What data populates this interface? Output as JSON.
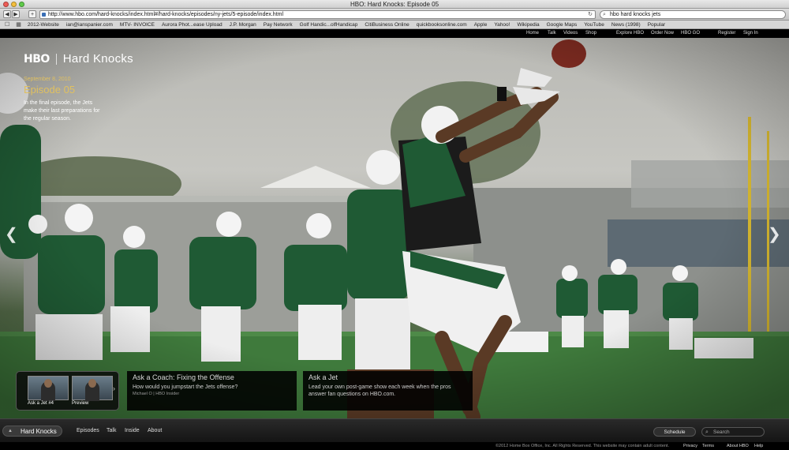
{
  "window": {
    "title": "HBO: Hard Knocks: Episode 05"
  },
  "browser": {
    "url": "http://www.hbo.com/hard-knocks/index.html#/hard-knocks/episodes/ny-jets/5-episode/index.html",
    "search_value": "hbo hard knocks jets",
    "bookmarks": [
      "2012-Website",
      "ian@ianspanier.com",
      "MTV- INVOICE",
      "Aurora Phot...ease Upload",
      "J.P. Morgan",
      "Pay Network",
      "Golf Handic...olfHandicap",
      "CitiBusiness Online",
      "quickbooksonline.com",
      "Apple",
      "Yahoo!",
      "Wikipedia",
      "Google Maps",
      "YouTube",
      "News (1998)",
      "Popular"
    ]
  },
  "hbo_nav": {
    "left": [
      "Home",
      "Talk",
      "Videos",
      "Shop"
    ],
    "middle": [
      "Explore HBO",
      "Order Now",
      "HBO GO"
    ],
    "right": [
      "Register",
      "Sign In"
    ]
  },
  "hero": {
    "logo": "HBO",
    "show": "Hard Knocks",
    "date": "September 8, 2010",
    "episode": "Episode 05",
    "description": "In the final episode, the Jets make their last preparations for the regular season."
  },
  "video_box": {
    "thumbs": [
      {
        "label": "Ask a Jet #4"
      },
      {
        "label": "Preview"
      }
    ]
  },
  "promos": [
    {
      "title": "Ask a Coach: Fixing the Offense",
      "body": "How would you jumpstart the Jets offense?",
      "byline": "Michael O | HBO Insider"
    },
    {
      "title": "Ask a Jet",
      "body": "Lead your own post-game show each week when the pros answer fan questions on HBO.com.",
      "byline": ""
    }
  ],
  "footer": {
    "home": "Hard Knocks",
    "links": [
      "Episodes",
      "Talk",
      "Inside",
      "About"
    ],
    "schedule": "Schedule",
    "search_placeholder": "Search"
  },
  "legal": {
    "copyright": "©2012 Home Box Office, Inc. All Rights Reserved. This website may contain adult content.",
    "links": [
      "Privacy",
      "Terms",
      "About HBO",
      "Help"
    ]
  },
  "colors": {
    "accent_gold": "#e0c060",
    "jets_green": "#1f5a34"
  }
}
